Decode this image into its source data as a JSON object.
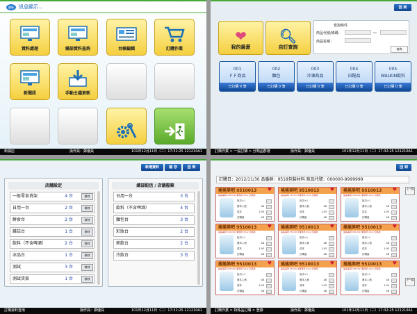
{
  "p1": {
    "notice_label": "訊息顯示...",
    "bubble_label": "最新",
    "tiles": [
      {
        "label": "資料處理",
        "type": "yellow",
        "icon": "monitor-icon"
      },
      {
        "label": "總部資料查詢",
        "type": "yellow",
        "icon": "monitor-icon"
      },
      {
        "label": "台帳編輯",
        "type": "yellow",
        "icon": "register-icon"
      },
      {
        "label": "訂購作業",
        "type": "yellow",
        "icon": "cart-icon"
      },
      {
        "label": "新聞訊",
        "type": "yellow",
        "icon": "monitor-icon"
      },
      {
        "label": "手動主檔更新",
        "type": "yellow",
        "icon": "download-icon"
      },
      {
        "label": "",
        "type": "empty"
      },
      {
        "label": "",
        "type": "empty"
      },
      {
        "label": "",
        "type": "empty"
      },
      {
        "label": "",
        "type": "empty"
      },
      {
        "label": "",
        "type": "yellow",
        "icon": "gear-wrench-icon"
      },
      {
        "label": "",
        "type": "green",
        "icon": "exit-icon"
      }
    ],
    "status": {
      "left": "新開店",
      "mid": "操作員：鄭優員",
      "right": "101年12月11日（二）17:32:25 121210A1"
    }
  },
  "p2": {
    "top_button": "回 到",
    "favorites_label": "我的最愛",
    "search_label": "自訂查詢",
    "query": {
      "title": "查詢條件",
      "code_label": "商品代號/條碼：",
      "name_label": "商品名稱：",
      "dash": "～",
      "search_button": "查詢"
    },
    "categories": [
      {
        "code": "001",
        "name": "ＦＦ商品",
        "ordered": "已訂購 0 筆"
      },
      {
        "code": "002",
        "name": "麵包",
        "ordered": "已訂購 0 筆"
      },
      {
        "code": "003",
        "name": "冷凍商品",
        "ordered": "已訂購 0 筆"
      },
      {
        "code": "004",
        "name": "日配品",
        "ordered": "已訂購 0 筆"
      },
      {
        "code": "005",
        "name": "WALKIN飲料",
        "ordered": "已訂購 0 筆"
      }
    ],
    "status": {
      "left": "訂購作業 > 一般訂購 > 分類品群選",
      "mid": "操作員：鄭優員",
      "right": "101年12月11日（二）17:32:25 121210A1"
    }
  },
  "p3": {
    "buttons": [
      "新增資料",
      "儲 存",
      "回 到"
    ],
    "left_title": "店舖設定",
    "right_title": "總部配信 / 店舖廢棄",
    "left_rows": [
      {
        "name": "一般零食貨架",
        "qty": "4 台",
        "btn": "移除"
      },
      {
        "name": "日用一台",
        "qty": "2 台",
        "btn": "移除"
      },
      {
        "name": "鮮食台",
        "qty": "2 台",
        "btn": "移除"
      },
      {
        "name": "雜誌台",
        "qty": "1 台",
        "btn": "移除"
      },
      {
        "name": "飲料（不含啤酒）",
        "qty": "2 台",
        "btn": "移除"
      },
      {
        "name": "冰品台",
        "qty": "1 台",
        "btn": "移除"
      },
      {
        "name": "測試",
        "qty": "3 台",
        "btn": "移除"
      },
      {
        "name": "測試貨架",
        "qty": "1 台",
        "btn": "移除"
      }
    ],
    "right_rows": [
      {
        "name": "日用一台",
        "qty": "3 台"
      },
      {
        "name": "飲料（不含啤酒）",
        "qty": "4 台"
      },
      {
        "name": "麵包台",
        "qty": "3 台"
      },
      {
        "name": "彩妝台",
        "qty": "2 台"
      },
      {
        "name": "熱飲台",
        "qty": "2 台"
      },
      {
        "name": "冷飲台",
        "qty": "3 台"
      }
    ],
    "status": {
      "left": "訂購資料查用",
      "mid": "操作員：鄭優員",
      "right": "101年12月11日（二）17:32:25 121210A1"
    }
  },
  "p4": {
    "top_button": "回 到",
    "header": "訂購日：2012/11/30 品番群：9518包裝材料 商品代號：000000-9999999",
    "cards": [
      {
        "title": "搖搖美吧 9510013",
        "sub": "搖搖美吧 9510013寶特杯 20oz 訂購用",
        "k1": "批次×1",
        "k2": "基本入數",
        "v2": "48",
        "k3": "成本",
        "v3": "1.93",
        "k4": "訂購量",
        "v4": "48"
      }
    ],
    "side_labels": [
      "上一頁",
      "下一頁"
    ],
    "status": {
      "left": "訂購作業 > 特殊品訂購 > 登錄",
      "mid": "操作員：鄭優員",
      "right": "101年12月11日（二）17:32:25 121210A1"
    }
  }
}
